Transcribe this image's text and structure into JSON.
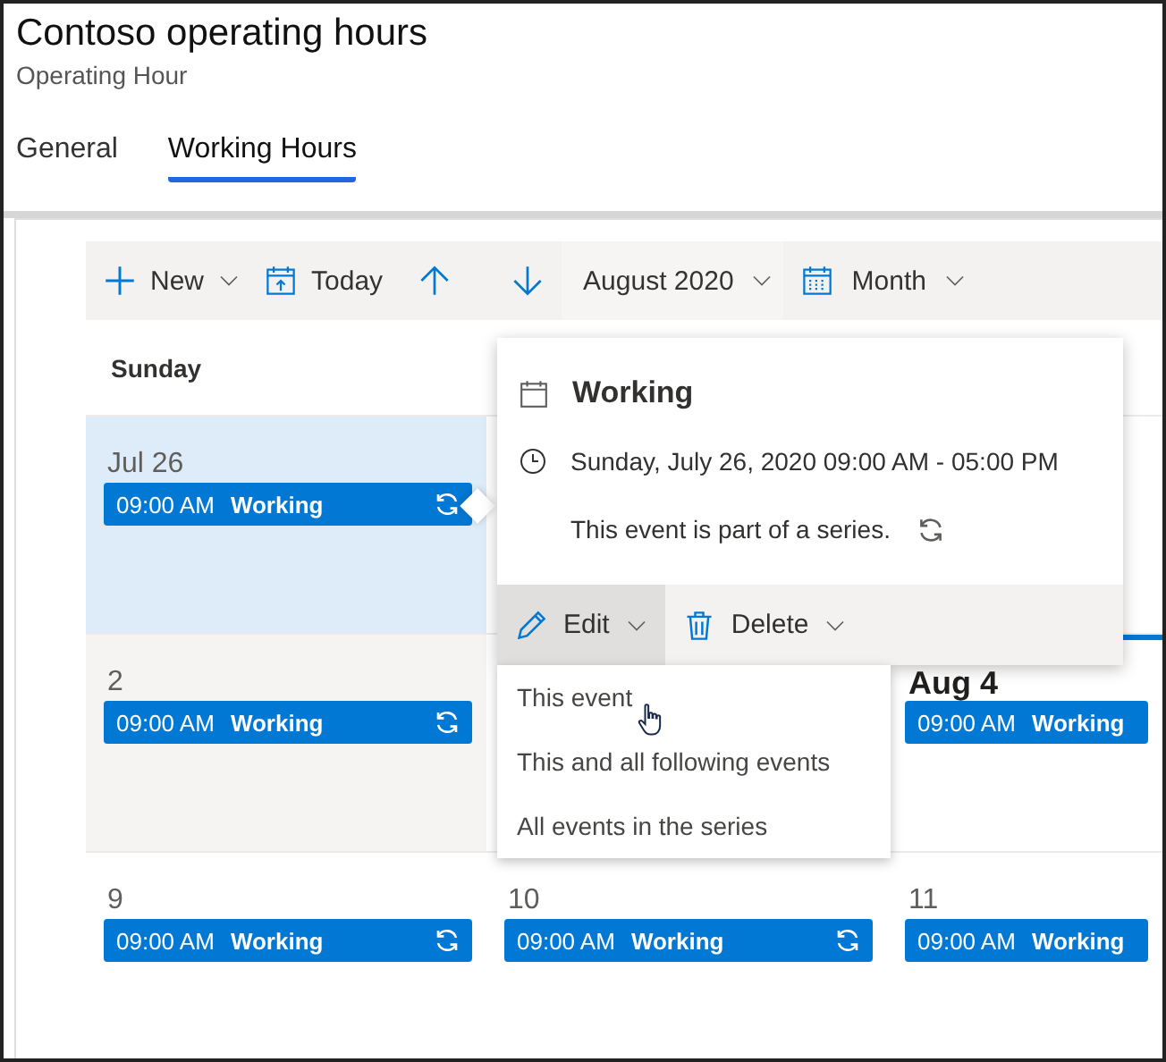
{
  "header": {
    "title": "Contoso operating hours",
    "subtitle": "Operating Hour"
  },
  "tabs": [
    {
      "label": "General",
      "selected": false
    },
    {
      "label": "Working Hours",
      "selected": true
    }
  ],
  "toolbar": [
    {
      "kind": "new",
      "label": "New",
      "dropdown": true
    },
    {
      "kind": "today",
      "label": "Today",
      "dropdown": false
    },
    {
      "kind": "up",
      "dropdown": false
    },
    {
      "kind": "down",
      "dropdown": false
    },
    {
      "kind": "period",
      "label": "August 2020",
      "dropdown": true
    },
    {
      "kind": "view",
      "label": "Month",
      "dropdown": true
    }
  ],
  "calendar": {
    "day_headers": [
      "Sunday"
    ],
    "weeks": [
      [
        {
          "date": "Jul 26",
          "selected": true,
          "shaded": false,
          "today": false,
          "events": [
            {
              "time": "09:00 AM",
              "title": "Working",
              "recurring": true
            }
          ]
        },
        {
          "selected": false,
          "shaded": false,
          "today": false
        },
        {
          "selected": false,
          "shaded": false,
          "today": false
        }
      ],
      [
        {
          "date": "2",
          "selected": false,
          "shaded": true,
          "today": false,
          "events": [
            {
              "time": "09:00 AM",
              "title": "Working",
              "recurring": true
            }
          ]
        },
        {
          "selected": false,
          "shaded": false,
          "today": false
        },
        {
          "date": "Aug 4",
          "selected": false,
          "shaded": false,
          "today": true,
          "events": [
            {
              "time": "09:00 AM",
              "title": "Working",
              "recurring": false
            }
          ]
        }
      ],
      [
        {
          "date": "9",
          "selected": false,
          "shaded": false,
          "today": false,
          "events": [
            {
              "time": "09:00 AM",
              "title": "Working",
              "recurring": true
            }
          ]
        },
        {
          "date": "10",
          "selected": false,
          "shaded": false,
          "today": false,
          "events": [
            {
              "time": "09:00 AM",
              "title": "Working",
              "recurring": true
            }
          ]
        },
        {
          "date": "11",
          "selected": false,
          "shaded": false,
          "today": false,
          "events": [
            {
              "time": "09:00 AM",
              "title": "Working",
              "recurring": false
            }
          ]
        }
      ]
    ]
  },
  "popup": {
    "title": "Working",
    "when": "Sunday, July 26, 2020 09:00 AM - 05:00 PM",
    "series_note": "This event is part of a series.",
    "actions": [
      {
        "kind": "edit",
        "label": "Edit",
        "pressed": true
      },
      {
        "kind": "delete",
        "label": "Delete",
        "pressed": false
      }
    ]
  },
  "edit_menu": {
    "items": [
      "This event",
      "This and all following events",
      "All events in the series"
    ]
  }
}
